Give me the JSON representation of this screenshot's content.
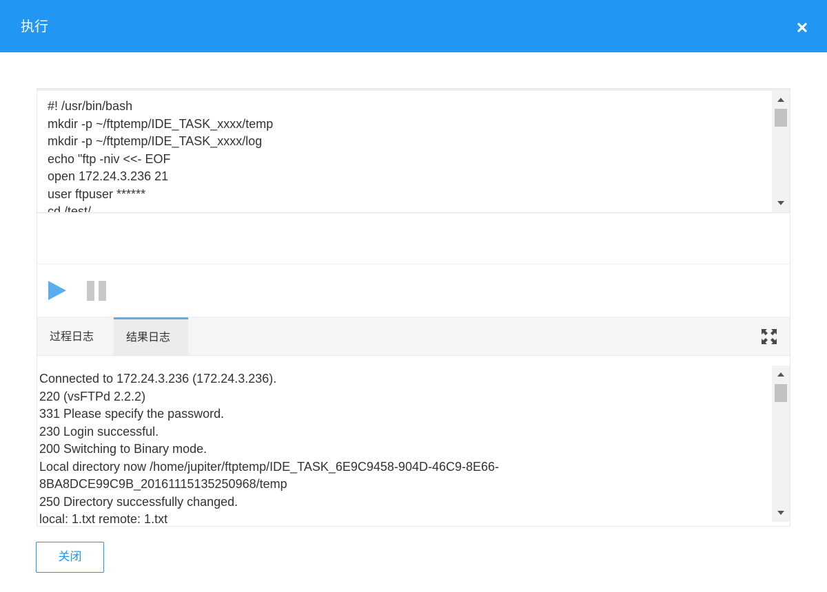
{
  "dialog": {
    "title": "执行"
  },
  "script": {
    "lines": [
      "#! /usr/bin/bash",
      "mkdir -p ~/ftptemp/IDE_TASK_xxxx/temp",
      "mkdir -p ~/ftptemp/IDE_TASK_xxxx/log",
      "echo \"ftp -niv <<- EOF",
      "open 172.24.3.236 21",
      "user ftpuser ******",
      "cd /test/"
    ]
  },
  "tabs": [
    {
      "label": "过程日志",
      "active": false
    },
    {
      "label": "结果日志",
      "active": true
    }
  ],
  "result": {
    "lines": [
      "Connected to 172.24.3.236 (172.24.3.236).",
      "220 (vsFTPd 2.2.2)",
      "331 Please specify the password.",
      "230 Login successful.",
      "200 Switching to Binary mode.",
      "Local directory now /home/jupiter/ftptemp/IDE_TASK_6E9C9458-904D-46C9-8E66-",
      "8BA8DCE99C9B_20161115135250968/temp",
      "250 Directory successfully changed.",
      "local: 1.txt remote: 1.txt"
    ]
  },
  "footer": {
    "close_label": "关闭"
  },
  "colors": {
    "header": "#2196f3",
    "play": "#5aaef0",
    "pause": "#c8c8c8",
    "tab_active_border": "#58aef2"
  },
  "icons": {
    "close": "close-icon",
    "play": "play-icon",
    "pause": "pause-icon",
    "expand": "fullscreen-icon"
  }
}
